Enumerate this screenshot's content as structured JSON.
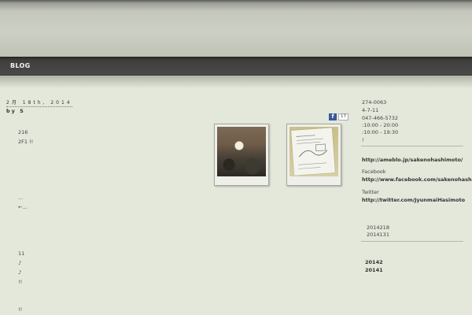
{
  "nav": {
    "items": [
      "BLOG"
    ]
  },
  "post": {
    "date": "2月 18th, 2014",
    "author": "by S",
    "facebook_like_count": "17",
    "lines": [
      "216",
      "2F1 !!",
      "...",
      "←...",
      "11",
      "♪",
      "♪",
      "!!",
      "!!"
    ]
  },
  "photos": [
    {
      "name": "photo-meeting-room"
    },
    {
      "name": "photo-handout-paper"
    }
  ],
  "sidebar": {
    "info": [
      "274-0063",
      "4-7-11",
      "047-466-5732",
      ":10:00 - 20:00",
      ":10:00 - 19:30",
      "!"
    ],
    "ameblo_url": "http://ameblo.jp/sakenohashimoto/",
    "facebook_label": "Facebook",
    "facebook_url": "http://www.facebook.com/sakenohashimoto",
    "twitter_label": "Twitter",
    "twitter_url": "http://twitter.com/JyunmaiHasimoto",
    "recent_posts": [
      "2014218",
      "2014131"
    ],
    "archives": [
      "20142",
      "20141"
    ]
  },
  "colors": {
    "background": "#e3e8da",
    "nav_bar": "#454442",
    "facebook": "#3b5998"
  }
}
